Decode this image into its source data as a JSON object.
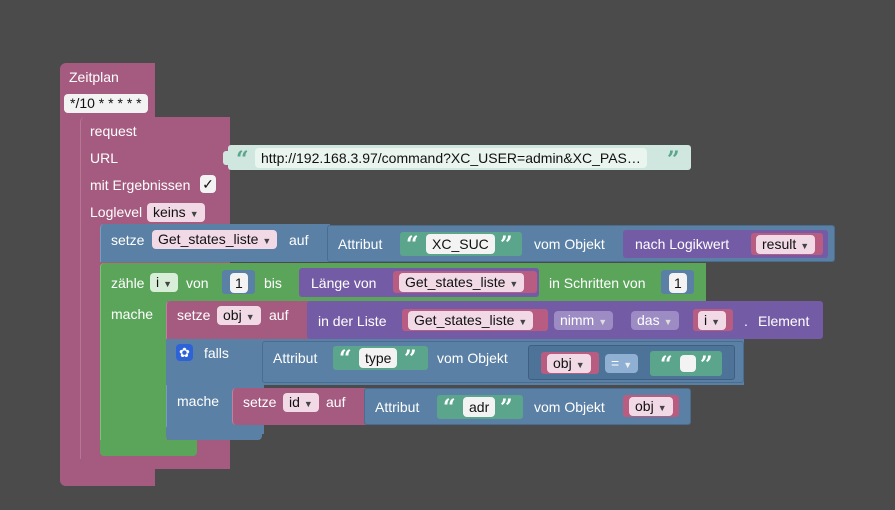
{
  "schedule": {
    "label": "Zeitplan",
    "cron": "*/10 * * * * *"
  },
  "request": {
    "label": "request",
    "url_label": "URL",
    "url_value": "http://192.168.3.97/command?XC_USER=admin&XC_PAS…",
    "results_label": "mit Ergebnissen",
    "results_check": "✓",
    "loglevel_label": "Loglevel",
    "loglevel_value": "keins"
  },
  "set1": {
    "setze": "setze",
    "var": "Get_states_liste",
    "auf": "auf",
    "attr_label": "Attribut",
    "attr_value": "XC_SUC",
    "obj_label": "vom Objekt",
    "logic_label": "nach Logikwert",
    "logic_var": "result"
  },
  "loop": {
    "zaehle": "zähle",
    "var": "i",
    "von": "von",
    "from": "1",
    "bis": "bis",
    "len_label": "Länge von",
    "len_var": "Get_states_liste",
    "step_label": "in Schritten von",
    "step": "1",
    "mache": "mache"
  },
  "set2": {
    "setze": "setze",
    "var": "obj",
    "auf": "auf",
    "list_label": "in der Liste",
    "list_var": "Get_states_liste",
    "nimm": "nimm",
    "das": "das",
    "idx": "i",
    "dot": ".",
    "element": "Element"
  },
  "if": {
    "falls": "falls",
    "attr_label": "Attribut",
    "attr_value": "type",
    "obj_label": "vom Objekt",
    "obj_var": "obj",
    "op": "=",
    "mache": "mache"
  },
  "set3": {
    "setze": "setze",
    "var": "id",
    "auf": "auf",
    "attr_label": "Attribut",
    "attr_value": "adr",
    "obj_label": "vom Objekt",
    "obj_var": "obj"
  }
}
